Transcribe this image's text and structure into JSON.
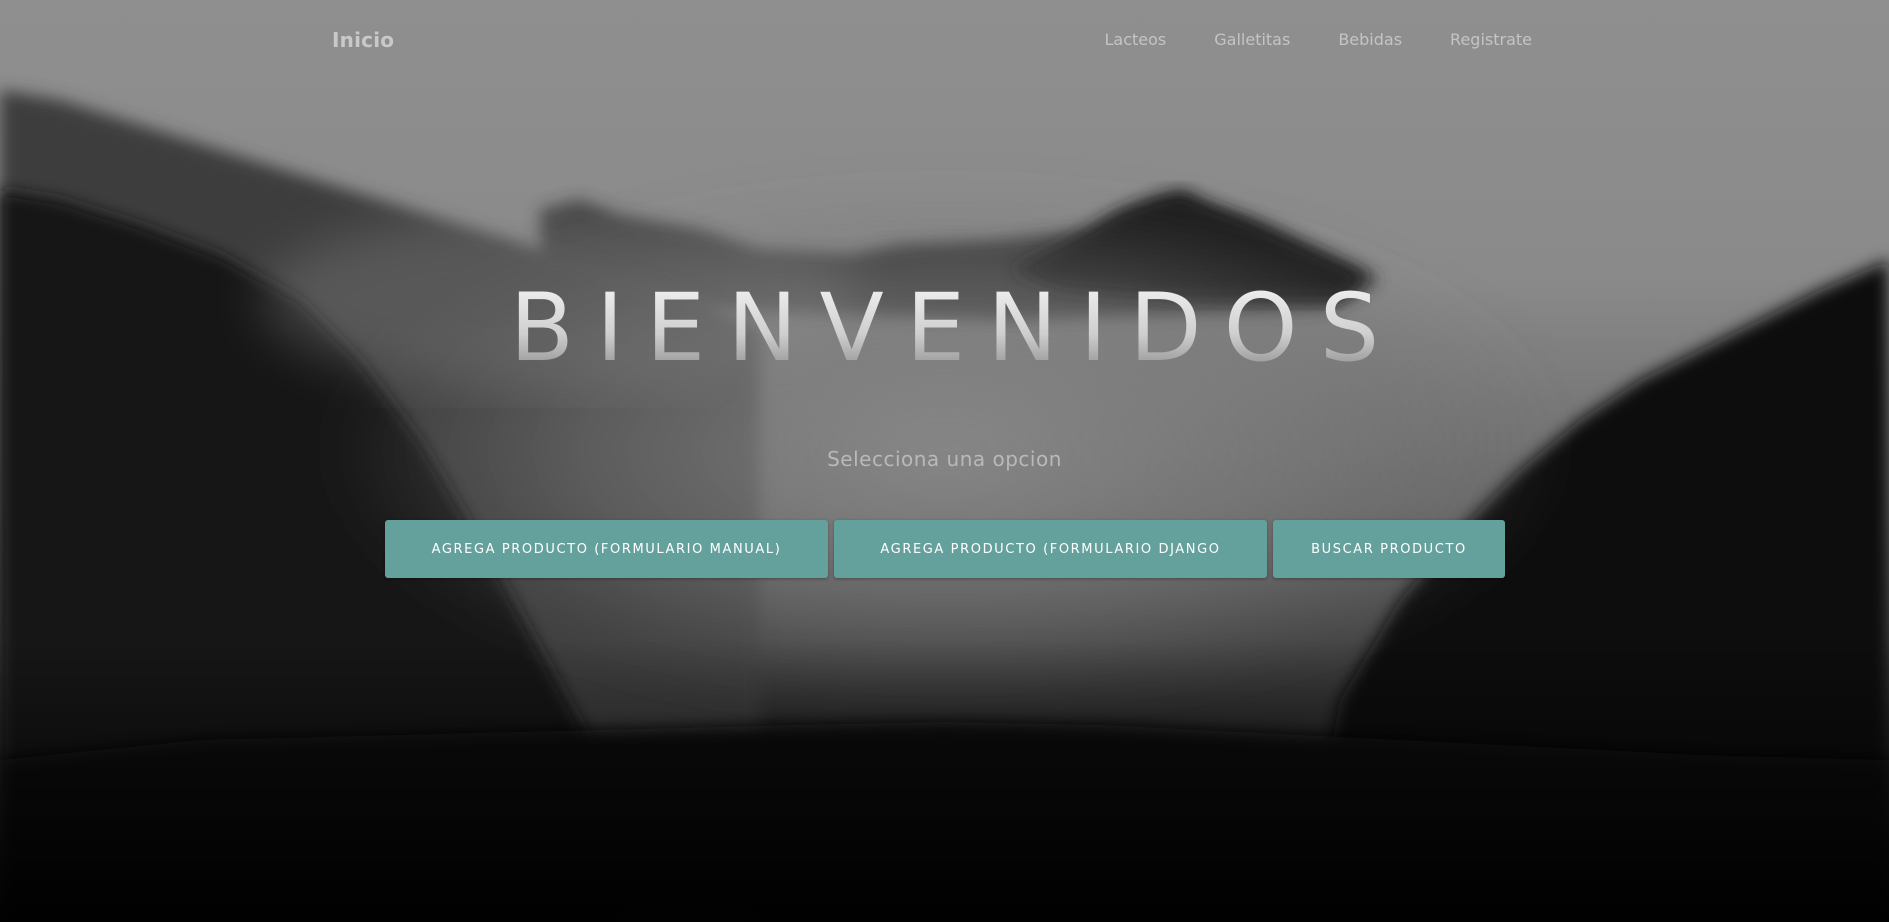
{
  "navbar": {
    "brand": "Inicio",
    "links": [
      {
        "label": "Lacteos"
      },
      {
        "label": "Galletitas"
      },
      {
        "label": "Bebidas"
      },
      {
        "label": "Registrate"
      }
    ]
  },
  "masthead": {
    "heading": "BIENVENIDOS",
    "subtitle": "Selecciona una opcion",
    "buttons": [
      {
        "label": "Agrega producto (formulario manual)"
      },
      {
        "label": "Agrega producto (formulario Django"
      },
      {
        "label": "Buscar producto"
      }
    ]
  },
  "colors": {
    "button": "#64a19d",
    "button_text": "#ffffff",
    "nav_text": "#c4c4c4"
  },
  "icons": {
    "background": "misty-mountain-forest-image"
  }
}
